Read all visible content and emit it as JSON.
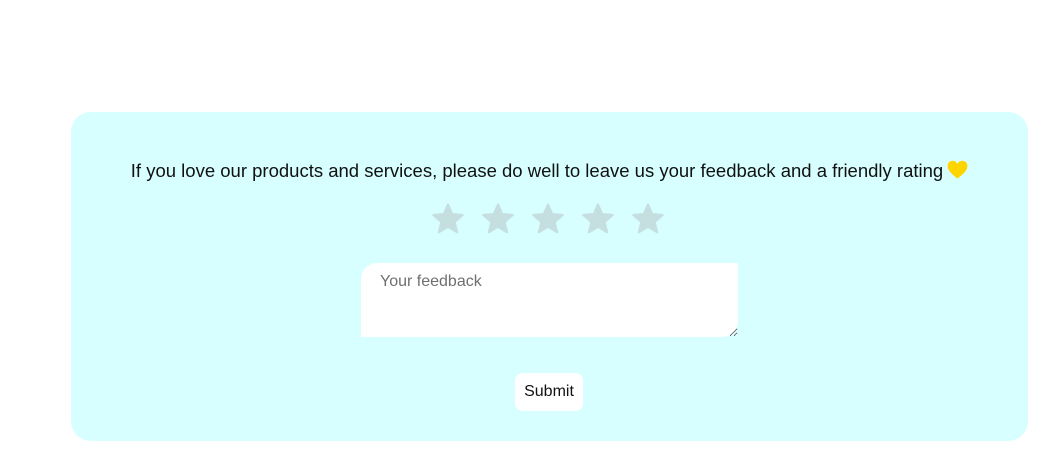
{
  "feedback_card": {
    "message": "If you love our products and services, please do well to leave us your feedback and a friendly rating",
    "heart_icon": "yellow-heart-icon",
    "heart_color": "#ffd500",
    "rating": {
      "max_stars": 5,
      "selected": 0,
      "star_color": "#c5dfe0",
      "icon": "star-icon"
    },
    "feedback_input": {
      "placeholder": "Your feedback",
      "value": ""
    },
    "submit_label": "Submit",
    "background_color": "#d7ffff"
  }
}
